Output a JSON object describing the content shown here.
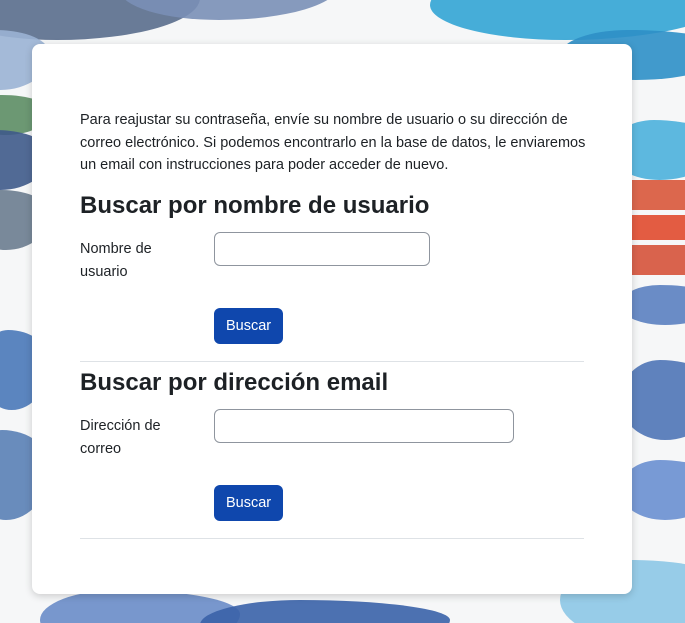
{
  "intro_text": "Para reajustar su contraseña, envíe su nombre de usuario o su dirección de correo electrónico. Si podemos encontrarlo en la base de datos, le enviaremos un email con instrucciones para poder acceder de nuevo.",
  "username_section": {
    "title": "Buscar por nombre de usuario",
    "field_label": "Nombre de usuario",
    "input_value": "",
    "button_label": "Buscar"
  },
  "email_section": {
    "title": "Buscar por dirección email",
    "field_label": "Dirección de correo",
    "input_value": "",
    "button_label": "Buscar"
  },
  "colors": {
    "button": "#0f47ad",
    "text": "#1d2125",
    "input_border": "#8f959e",
    "divider": "#dee2e6"
  }
}
